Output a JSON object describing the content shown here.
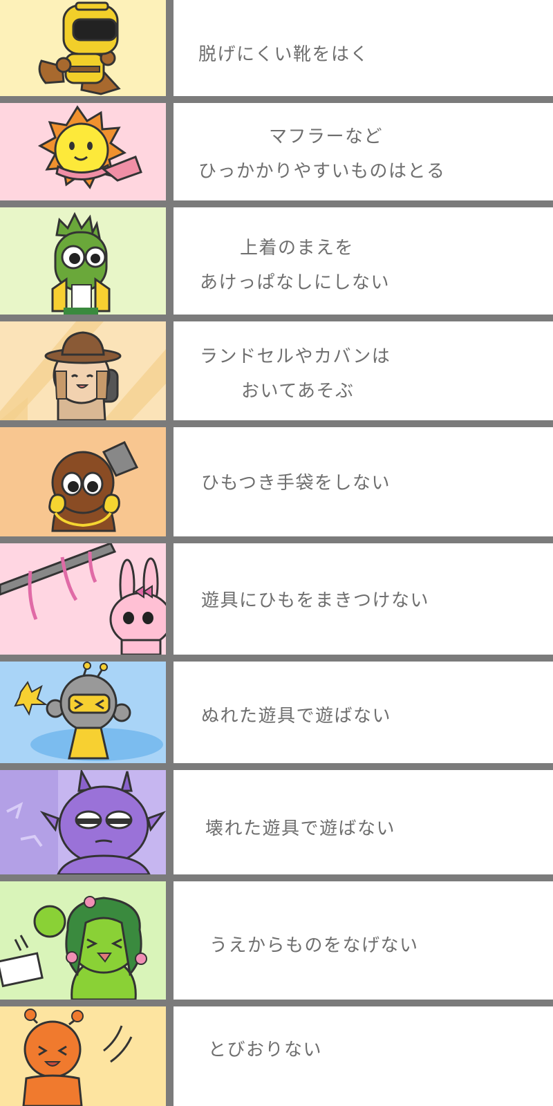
{
  "rules": [
    {
      "lines": [
        "脱げにくい靴をはく"
      ],
      "bg": "#fdf1b9",
      "character": "yellow-helmet-robot-icon"
    },
    {
      "lines": [
        "マフラーなど",
        "ひっかかりやすいものはとる"
      ],
      "bg": "#ffd6df",
      "character": "sun-with-scarf-icon"
    },
    {
      "lines": [
        "上着のまえを",
        "あけっぱなしにしない"
      ],
      "bg": "#e8f6c8",
      "character": "green-spiky-character-icon"
    },
    {
      "lines": [
        "ランドセルやカバンは",
        "おいてあそぶ"
      ],
      "bg": "#fbe3b8",
      "character": "hat-child-with-backpack-icon"
    },
    {
      "lines": [
        "ひもつき手袋をしない"
      ],
      "bg": "#f8c690",
      "character": "brown-character-with-gloves-icon"
    },
    {
      "lines": [
        "遊具にひもをまきつけない"
      ],
      "bg": "#ffd6e2",
      "character": "pink-rabbit-icon"
    },
    {
      "lines": [
        "ぬれた遊具で遊ばない"
      ],
      "bg": "#a9d4f7",
      "character": "robot-slipping-icon"
    },
    {
      "lines": [
        "壊れた遊具で遊ばない"
      ],
      "bg": "#c6b6f0",
      "character": "purple-horned-character-icon"
    },
    {
      "lines": [
        "うえからものをなげない"
      ],
      "bg": "#d9f4b9",
      "character": "green-flower-character-icon"
    },
    {
      "lines": [
        "とびおりない"
      ],
      "bg": "#fde4a0",
      "character": "orange-jumping-character-icon"
    }
  ]
}
